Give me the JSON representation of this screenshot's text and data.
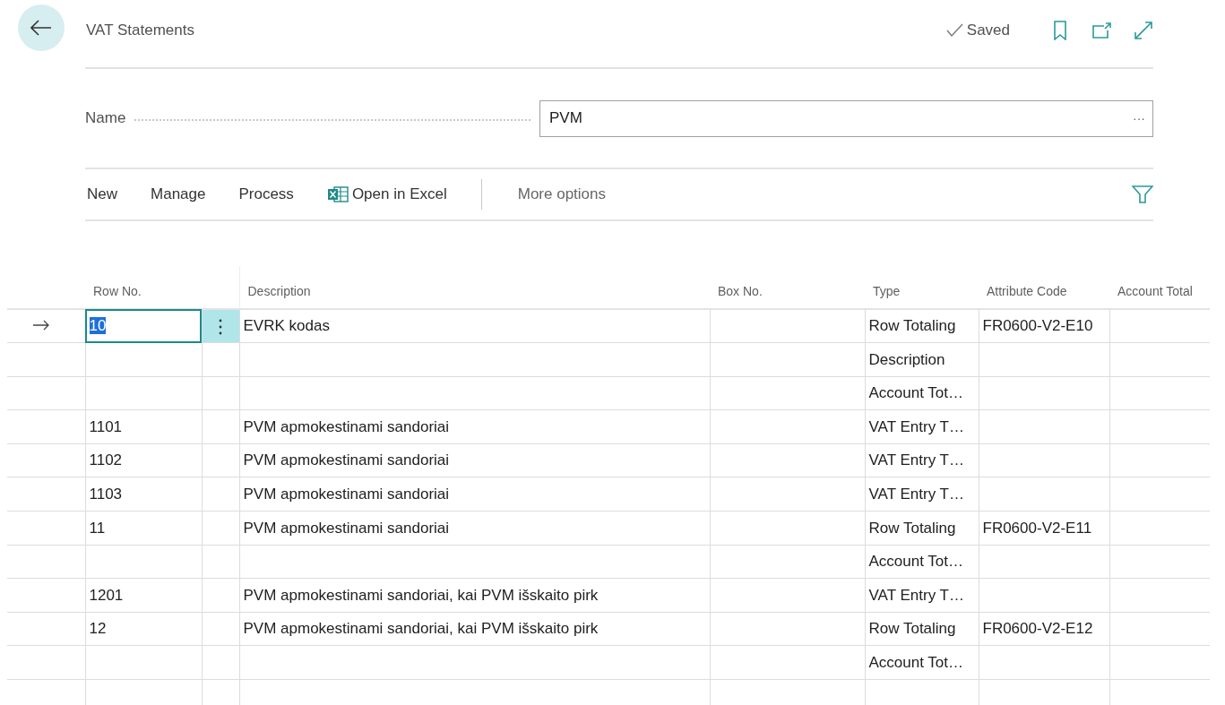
{
  "page": {
    "title": "VAT Statements",
    "save_status": "Saved"
  },
  "name_field": {
    "label": "Name",
    "value": "PVM",
    "assist": "···"
  },
  "actions": [
    {
      "label": "New",
      "kind": "menu"
    },
    {
      "label": "Manage",
      "kind": "menu"
    },
    {
      "label": "Process",
      "kind": "menu"
    },
    {
      "label": "Open in Excel",
      "kind": "excel"
    },
    {
      "label": "More options",
      "kind": "more"
    }
  ],
  "table": {
    "columns": [
      "Row No.",
      "Description",
      "Box No.",
      "Type",
      "Attribute Code",
      "Account Total"
    ],
    "rows": [
      {
        "row_no": "10",
        "description": "EVRK kodas",
        "type": "Row Totaling",
        "attribute_code": "FR0600-V2-E10",
        "selected": true
      },
      {
        "row_no": "",
        "description": "",
        "type": "Description",
        "attribute_code": "",
        "selected": false
      },
      {
        "row_no": "",
        "description": "",
        "type": "Account Tot…",
        "attribute_code": "",
        "selected": false
      },
      {
        "row_no": "1101",
        "description": "PVM apmokestinami sandoriai",
        "type": "VAT Entry T…",
        "attribute_code": "",
        "selected": false
      },
      {
        "row_no": "1102",
        "description": "PVM apmokestinami sandoriai",
        "type": "VAT Entry T…",
        "attribute_code": "",
        "selected": false
      },
      {
        "row_no": "1103",
        "description": "PVM apmokestinami sandoriai",
        "type": "VAT Entry T…",
        "attribute_code": "",
        "selected": false
      },
      {
        "row_no": "11",
        "description": "PVM apmokestinami sandoriai",
        "type": "Row Totaling",
        "attribute_code": "FR0600-V2-E11",
        "selected": false
      },
      {
        "row_no": "",
        "description": "",
        "type": "Account Tot…",
        "attribute_code": "",
        "selected": false
      },
      {
        "row_no": "1201",
        "description": "PVM apmokestinami sandoriai, kai PVM išskaito pirk",
        "type": "VAT Entry T…",
        "attribute_code": "",
        "selected": false
      },
      {
        "row_no": "12",
        "description": "PVM apmokestinami sandoriai, kai PVM išskaito pirk",
        "type": "Row Totaling",
        "attribute_code": "FR0600-V2-E12",
        "selected": false
      },
      {
        "row_no": "",
        "description": "",
        "type": "Account Tot…",
        "attribute_code": "",
        "selected": false
      }
    ]
  }
}
